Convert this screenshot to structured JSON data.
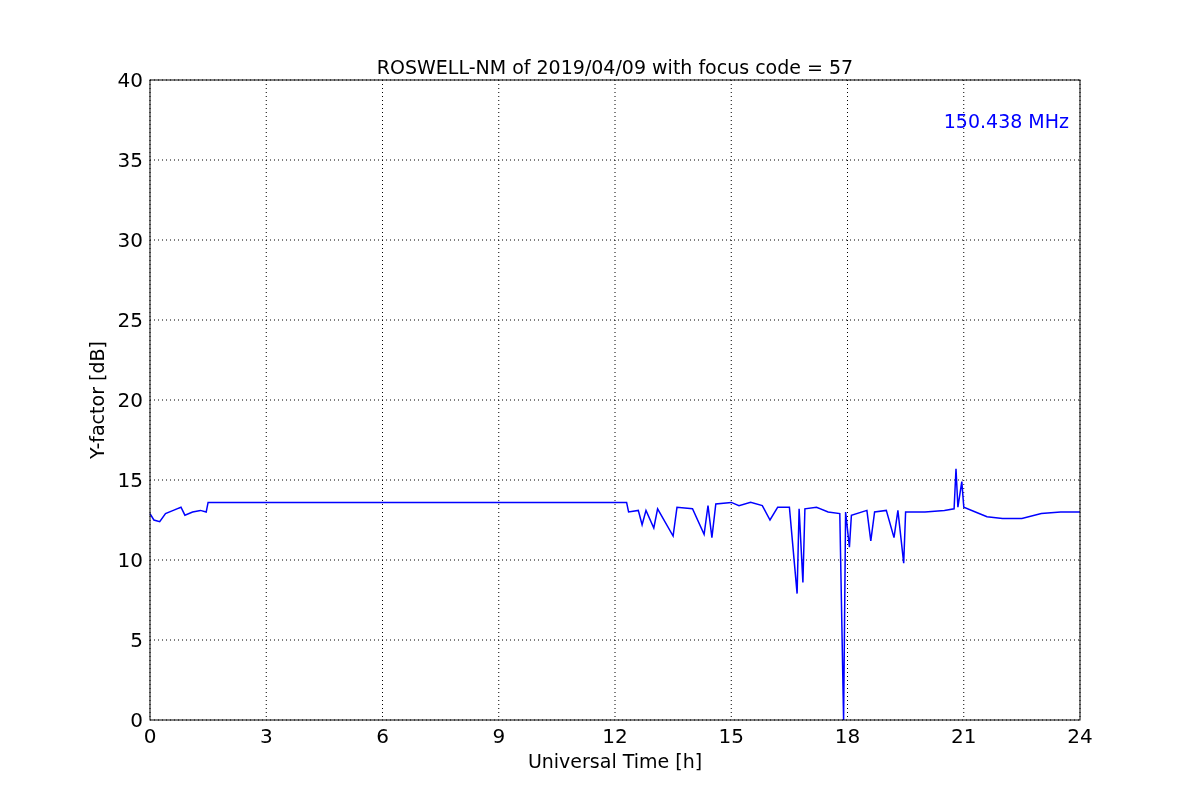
{
  "figure": {
    "chart_data": {
      "type": "line",
      "title": "ROSWELL-NM of 2019/04/09 with focus code = 57",
      "xlabel": "Universal Time [h]",
      "ylabel": "Y-factor [dB]",
      "x": [
        0,
        0.1,
        0.25,
        0.4,
        0.6,
        0.8,
        0.9,
        1.1,
        1.3,
        1.45,
        1.5,
        12.3,
        12.35,
        12.6,
        12.7,
        12.8,
        13.0,
        13.1,
        13.5,
        13.6,
        14.0,
        14.3,
        14.4,
        14.5,
        14.6,
        15.0,
        15.2,
        15.5,
        15.8,
        16.0,
        16.2,
        16.5,
        16.7,
        16.75,
        16.85,
        16.9,
        17.2,
        17.5,
        17.8,
        17.9,
        17.95,
        18.05,
        18.1,
        18.5,
        18.6,
        18.7,
        19.0,
        19.2,
        19.3,
        19.45,
        19.5,
        20.0,
        20.5,
        20.75,
        20.8,
        20.85,
        20.95,
        21.0,
        21.3,
        21.6,
        22.0,
        22.5,
        23.0,
        23.5,
        24.0
      ],
      "series": [
        {
          "name": "150.438 MHz",
          "color": "#0000ff",
          "values": [
            12.9,
            12.5,
            12.4,
            12.9,
            13.1,
            13.3,
            12.8,
            13.0,
            13.1,
            13.0,
            13.6,
            13.6,
            13.0,
            13.1,
            12.2,
            13.1,
            12.0,
            13.2,
            11.5,
            13.3,
            13.2,
            11.6,
            13.4,
            11.4,
            13.5,
            13.6,
            13.4,
            13.6,
            13.4,
            12.5,
            13.3,
            13.3,
            7.9,
            13.2,
            8.6,
            13.2,
            13.3,
            13.0,
            12.9,
            0,
            13.0,
            10.8,
            12.8,
            13.1,
            11.2,
            13.0,
            13.1,
            11.4,
            13.1,
            9.8,
            13.0,
            13.0,
            13.1,
            13.2,
            15.7,
            13.3,
            14.9,
            13.3,
            13.0,
            12.7,
            12.6,
            12.6,
            12.9,
            13.0,
            13.0
          ]
        }
      ],
      "xlim": [
        0,
        24
      ],
      "ylim": [
        0,
        40
      ],
      "xticks": [
        0,
        3,
        6,
        9,
        12,
        15,
        18,
        21,
        24
      ],
      "yticks": [
        0,
        5,
        10,
        15,
        20,
        25,
        30,
        35,
        40
      ],
      "grid": true
    }
  }
}
